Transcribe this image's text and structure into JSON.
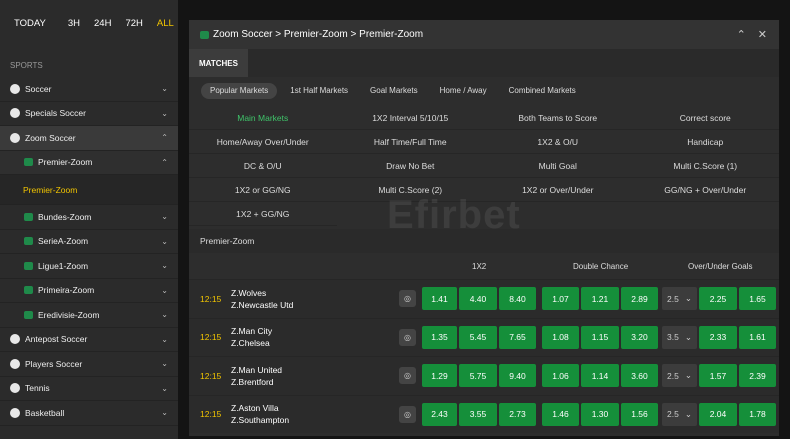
{
  "timefilter": {
    "today": "TODAY",
    "h3": "3H",
    "h24": "24H",
    "h72": "72H",
    "all": "ALL"
  },
  "sidebar": {
    "section": "SPORTS",
    "items": [
      {
        "label": "Soccer",
        "chev": "⌄"
      },
      {
        "label": "Specials Soccer",
        "chev": "⌄"
      },
      {
        "label": "Zoom Soccer",
        "chev": "⌃"
      },
      {
        "label": "Premier-Zoom",
        "chev": "⌃"
      },
      {
        "label": "Premier-Zoom"
      },
      {
        "label": "Bundes-Zoom",
        "chev": "⌄"
      },
      {
        "label": "SerieA-Zoom",
        "chev": "⌄"
      },
      {
        "label": "Ligue1-Zoom",
        "chev": "⌄"
      },
      {
        "label": "Primeira-Zoom",
        "chev": "⌄"
      },
      {
        "label": "Eredivisie-Zoom",
        "chev": "⌄"
      },
      {
        "label": "Antepost Soccer",
        "chev": "⌄"
      },
      {
        "label": "Players Soccer",
        "chev": "⌄"
      },
      {
        "label": "Tennis",
        "chev": "⌄"
      },
      {
        "label": "Basketball",
        "chev": "⌄"
      }
    ]
  },
  "panel": {
    "title": "Zoom Soccer > Premier-Zoom > Premier-Zoom",
    "collapse": "⌃",
    "close": "✕",
    "tab": "MATCHES",
    "subtabs": [
      "Popular Markets",
      "1st Half Markets",
      "Goal Markets",
      "Home / Away",
      "Combined Markets"
    ],
    "markets": [
      "Main Markets",
      "1X2 Interval 5/10/15",
      "Both Teams to Score",
      "Correct score",
      "Home/Away Over/Under",
      "Half Time/Full Time",
      "1X2 & O/U",
      "Handicap",
      "DC & O/U",
      "Draw No Bet",
      "Multi Goal",
      "Multi C.Score (1)",
      "1X2 or GG/NG",
      "Multi C.Score (2)",
      "1X2 or Over/Under",
      "GG/NG + Over/Under",
      "1X2 + GG/NG"
    ],
    "league": "Premier-Zoom",
    "columns": {
      "c1": "1X2",
      "c2": "Double Chance",
      "c3": "Over/Under Goals"
    }
  },
  "matches": [
    {
      "time": "12:15",
      "home": "Z.Wolves",
      "away": "Z.Newcastle Utd",
      "x12": [
        "1.41",
        "4.40",
        "8.40"
      ],
      "dc": [
        "1.07",
        "1.21",
        "2.89"
      ],
      "line": "2.5",
      "ou": [
        "2.25",
        "1.65"
      ]
    },
    {
      "time": "12:15",
      "home": "Z.Man City",
      "away": "Z.Chelsea",
      "x12": [
        "1.35",
        "5.45",
        "7.65"
      ],
      "dc": [
        "1.08",
        "1.15",
        "3.20"
      ],
      "line": "3.5",
      "ou": [
        "2.33",
        "1.61"
      ]
    },
    {
      "time": "12:15",
      "home": "Z.Man United",
      "away": "Z.Brentford",
      "x12": [
        "1.29",
        "5.75",
        "9.40"
      ],
      "dc": [
        "1.06",
        "1.14",
        "3.60"
      ],
      "line": "2.5",
      "ou": [
        "1.57",
        "2.39"
      ]
    },
    {
      "time": "12:15",
      "home": "Z.Aston Villa",
      "away": "Z.Southampton",
      "x12": [
        "2.43",
        "3.55",
        "2.73"
      ],
      "dc": [
        "1.46",
        "1.30",
        "1.56"
      ],
      "line": "2.5",
      "ou": [
        "2.04",
        "1.78"
      ]
    }
  ],
  "watermark": "Efirbet"
}
